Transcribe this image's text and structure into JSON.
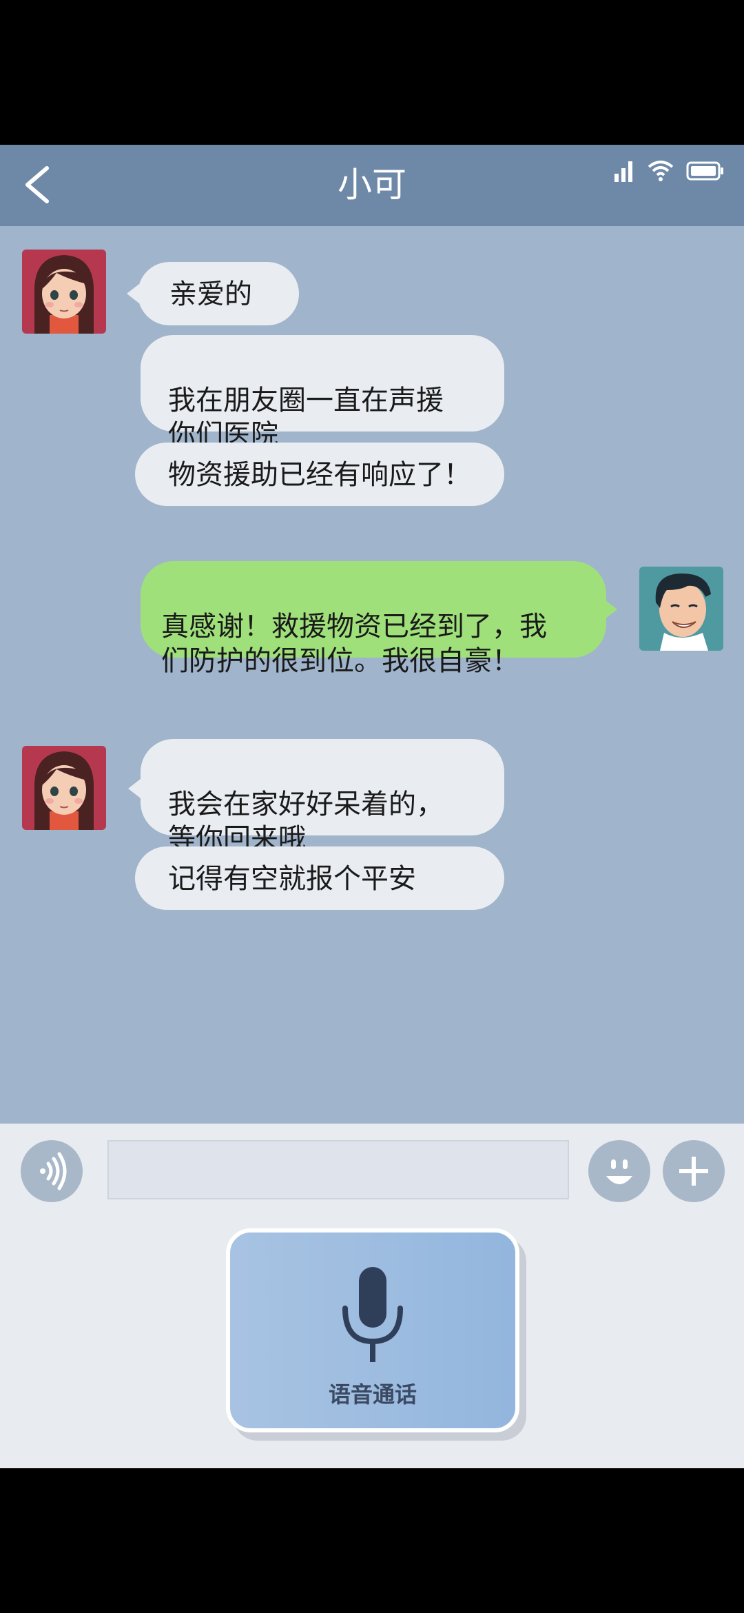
{
  "header": {
    "title": "小可",
    "back_icon": "chevron-left-icon",
    "status_icons": [
      "signal-icon",
      "wifi-icon",
      "battery-icon"
    ]
  },
  "messages": [
    {
      "sender": "contact",
      "text": "亲爱的"
    },
    {
      "sender": "contact",
      "text": "我在朋友圈一直在声援\n你们医院"
    },
    {
      "sender": "contact",
      "text": "物资援助已经有响应了！"
    },
    {
      "sender": "me",
      "text": "真感谢！救援物资已经到了，我\n们防护的很到位。我很自豪！"
    },
    {
      "sender": "contact",
      "text": "我会在家好好呆着的，\n等你回来哦"
    },
    {
      "sender": "contact",
      "text": "记得有空就报个平安"
    }
  ],
  "input_bar": {
    "voice_toggle_icon": "sound-wave-icon",
    "emoji_icon": "smiley-icon",
    "add_icon": "plus-icon",
    "text_value": ""
  },
  "voice_call": {
    "label": "语音通话",
    "icon": "microphone-icon"
  },
  "colors": {
    "header": "#6e89a7",
    "chat_background": "#a0b4cb",
    "incoming_bubble": "#e9edf2",
    "outgoing_bubble": "#9fe07b"
  }
}
